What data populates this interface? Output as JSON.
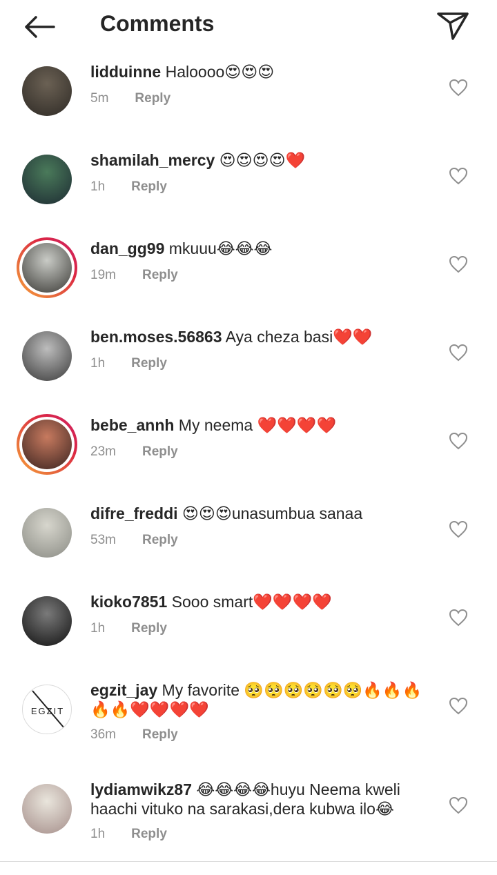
{
  "header": {
    "title": "Comments"
  },
  "reply_label": "Reply",
  "comments": [
    {
      "username": "lidduinne",
      "text": " Haloooo😍😍😍",
      "time": "5m",
      "story": false,
      "avatar_colors": [
        "#6b6154",
        "#2e2a25"
      ]
    },
    {
      "username": "shamilah_mercy",
      "text": " 😍😍😍😍❤️",
      "time": "1h",
      "story": false,
      "avatar_colors": [
        "#4a7a5a",
        "#1d2b33"
      ]
    },
    {
      "username": "dan_gg99",
      "text": " mkuuu😂😂😂",
      "time": "19m",
      "story": true,
      "avatar_colors": [
        "#c9cbc6",
        "#3b3a36"
      ]
    },
    {
      "username": "ben.moses.56863",
      "text": " Aya cheza basi❤️❤️",
      "time": "1h",
      "story": false,
      "avatar_colors": [
        "#bdbdbd",
        "#3a3a3a"
      ]
    },
    {
      "username": "bebe_annh",
      "text": " My neema ❤️❤️❤️❤️",
      "time": "23m",
      "story": true,
      "avatar_colors": [
        "#c77a5f",
        "#3b2420"
      ]
    },
    {
      "username": "difre_freddi",
      "text": " 😍😍😍unasumbua sanaa",
      "time": "53m",
      "story": false,
      "avatar_colors": [
        "#d7d6cd",
        "#8a8b84"
      ]
    },
    {
      "username": "kioko7851",
      "text": " Sooo smart❤️❤️❤️❤️",
      "time": "1h",
      "story": false,
      "avatar_colors": [
        "#7a7a7a",
        "#111111"
      ]
    },
    {
      "username": "egzit_jay",
      "text": " My favorite 🥺🥺🥺🥺🥺🥺🔥🔥🔥🔥🔥❤️❤️❤️❤️",
      "time": "36m",
      "story": false,
      "avatar_colors": [
        "#ffffff",
        "#ffffff"
      ],
      "avatar_text": "EGZIT"
    },
    {
      "username": "lydiamwikz87",
      "text": " 😂😂😂😂huyu Neema kweli haachi vituko na sarakasi,dera kubwa ilo😂",
      "time": "1h",
      "story": false,
      "avatar_colors": [
        "#e9e5dc",
        "#a58e8a"
      ]
    }
  ]
}
